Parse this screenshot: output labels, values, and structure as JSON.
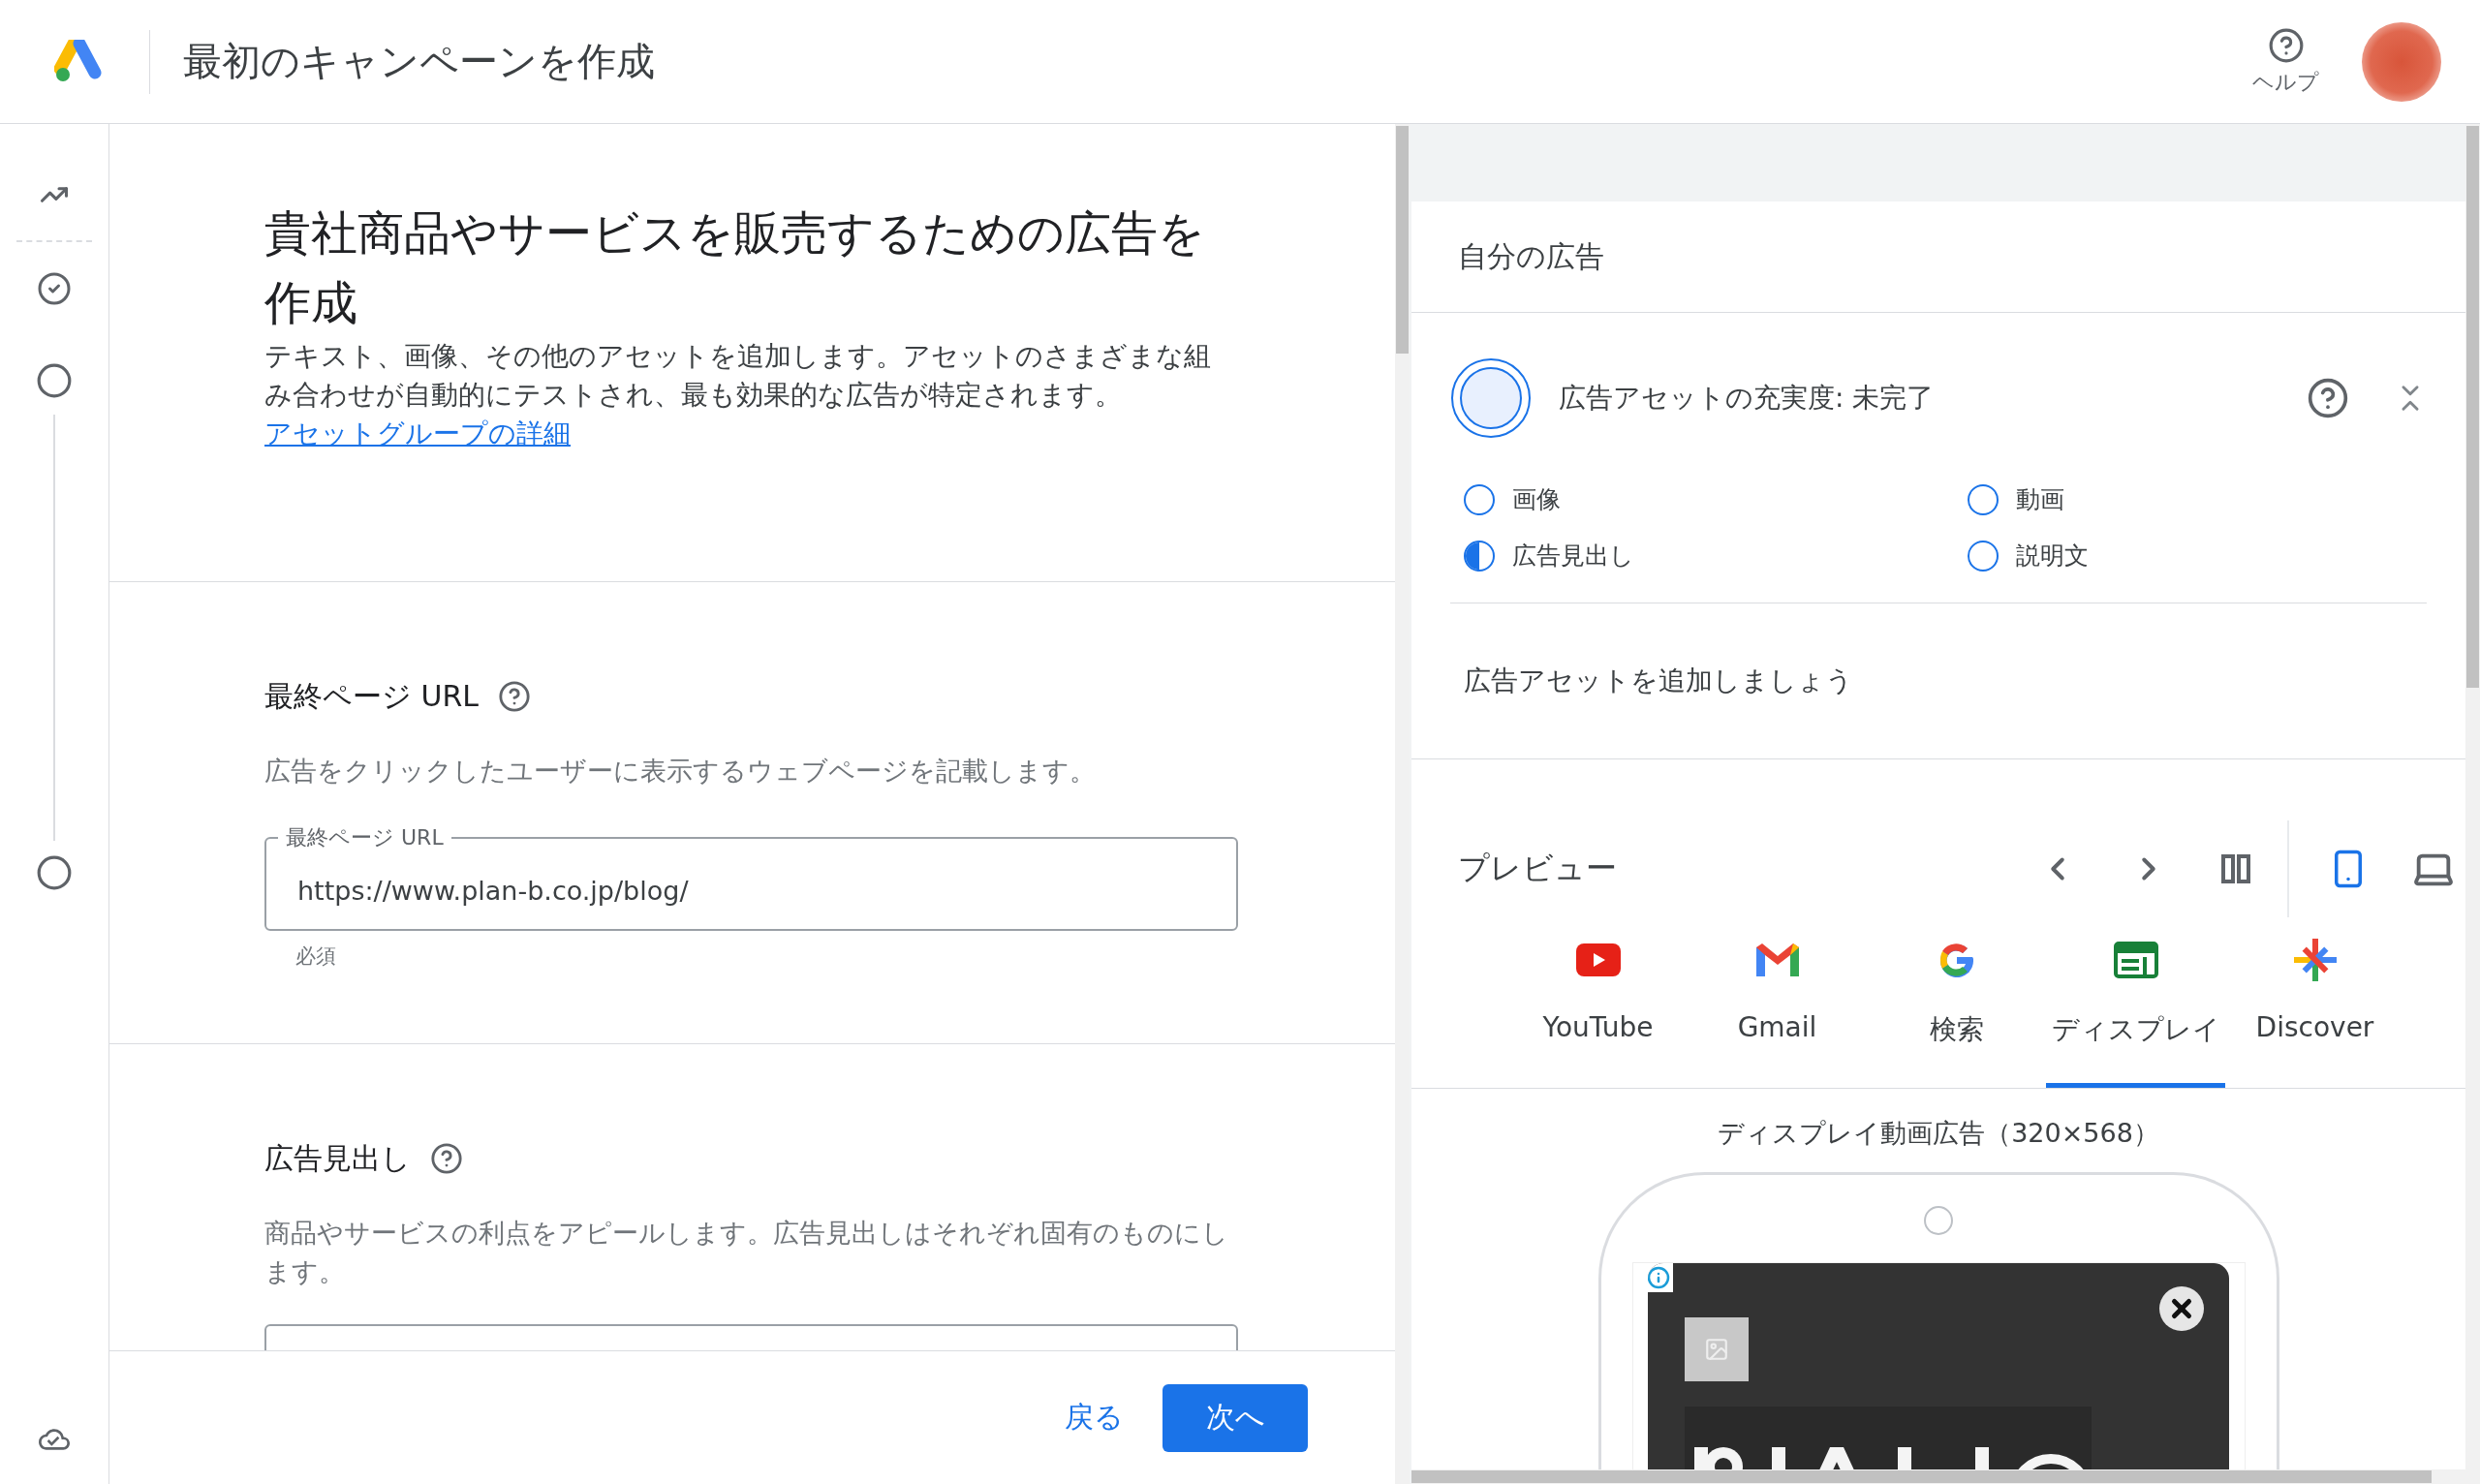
{
  "header": {
    "title": "最初のキャンペーンを作成",
    "help_label": "ヘルプ"
  },
  "steps": [
    {
      "completed": true
    },
    {
      "completed": false
    },
    {
      "completed": false
    }
  ],
  "intro": {
    "title": "貴社商品やサービスを販売するための広告を作成",
    "description": "テキスト、画像、その他のアセットを追加します。アセットのさまざまな組み合わせが自動的にテストされ、最も効果的な広告が特定されます。",
    "link": "アセットグループの詳細"
  },
  "final_url": {
    "heading": "最終ページ URL",
    "description": "広告をクリックしたユーザーに表示するウェブページを記載します。",
    "field_label": "最終ページ URL",
    "value": "https://www.plan-b.co.jp/blog/",
    "helper": "必須"
  },
  "headlines": {
    "heading": "広告見出し",
    "description": "商品やサービスの利点をアピールします。広告見出しはそれぞれ固有のものにします。"
  },
  "footer": {
    "back": "戻る",
    "next": "次へ"
  },
  "ad_panel": {
    "title": "自分の広告",
    "strength": "広告アセットの充実度: 未完了",
    "checklist": [
      {
        "label": "画像",
        "level": 0
      },
      {
        "label": "動画",
        "level": 0
      },
      {
        "label": "広告見出し",
        "level": 0.5
      },
      {
        "label": "説明文",
        "level": 0
      }
    ],
    "hint": "広告アセットを追加しましょう"
  },
  "preview": {
    "title": "プレビュー",
    "devices": [
      {
        "kind": "mobile",
        "selected": true
      },
      {
        "kind": "desktop",
        "selected": false
      }
    ],
    "tabs": [
      {
        "kind": "youtube",
        "label": "YouTube",
        "selected": false
      },
      {
        "kind": "gmail",
        "label": "Gmail",
        "selected": false
      },
      {
        "kind": "search",
        "label": "検索",
        "selected": false
      },
      {
        "kind": "display",
        "label": "ディスプレイ",
        "selected": true
      },
      {
        "kind": "discover",
        "label": "Discover",
        "selected": false
      }
    ],
    "format": "ディスプレイ動画広告（320×568）"
  }
}
